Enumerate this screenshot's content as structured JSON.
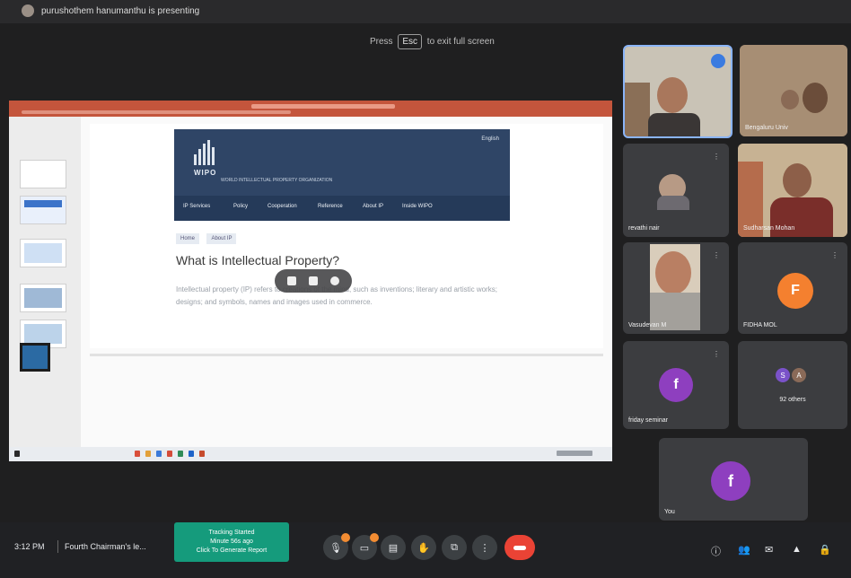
{
  "top_bar": {
    "presenter_text": "purushothem hanumanthu is presenting"
  },
  "fullscreen_hint": {
    "pre": "Press",
    "key": "Esc",
    "post": "to exit full screen"
  },
  "slide": {
    "org_name": "WIPO",
    "org_subtitle": "WORLD INTELLECTUAL PROPERTY ORGANIZATION",
    "lang": "English",
    "nav": [
      "IP Services",
      "Policy",
      "Cooperation",
      "Reference",
      "About IP",
      "Inside WIPO"
    ],
    "breadcrumbs": [
      "Home",
      "About IP"
    ],
    "title": "What is Intellectual Property?",
    "body": "Intellectual property (IP) refers to creations of the mind, such as inventions; literary and artistic works; designs; and symbols, names and images used in commerce."
  },
  "participants": [
    {
      "name": "",
      "type": "video",
      "active": true
    },
    {
      "name": "Bengaluru Univ",
      "type": "video"
    },
    {
      "name": "revathi nair",
      "type": "video"
    },
    {
      "name": "Sudharsan Mohan",
      "type": "video"
    },
    {
      "name": "Vasudevan M",
      "type": "video"
    },
    {
      "name": "FIDHA MOL",
      "type": "avatar",
      "letter": "F",
      "color": "#f4802f"
    },
    {
      "name": "friday seminar",
      "type": "avatar",
      "letter": "f",
      "color": "#8e3fbf"
    },
    {
      "name": "92 others",
      "type": "others",
      "avatars": [
        {
          "letter": "S",
          "color": "#7a52c9"
        },
        {
          "letter": "A",
          "color": "#8a6a58"
        }
      ]
    },
    {
      "name": "You",
      "type": "avatar",
      "letter": "f",
      "color": "#8e3fbf"
    }
  ],
  "bottom": {
    "time": "3:12 PM",
    "meeting_title": "Fourth Chairman's le...",
    "tracking": {
      "line1": "Tracking Started",
      "line2": "Minute 56s ago",
      "line3": "Click To Generate Report"
    }
  },
  "colors": {
    "hangup": "#ea4335",
    "tracking": "#159b7c",
    "active_tile_border": "#8ab4f8"
  }
}
